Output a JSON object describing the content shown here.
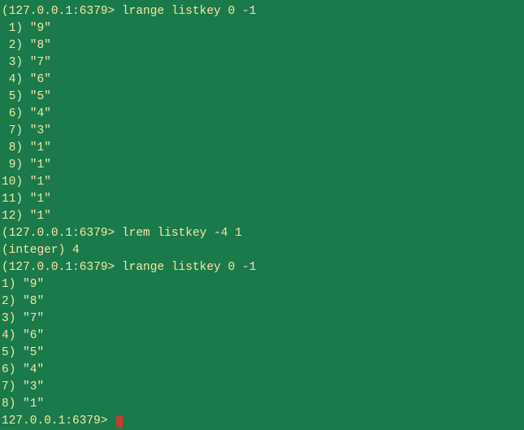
{
  "prompt": "127.0.0.1:6379>",
  "prompt_paren": "(127.0.0.1:6379>",
  "cmd1": "lrange listkey 0 -1",
  "list1": [
    {
      "idx": " 1)",
      "val": "\"9\""
    },
    {
      "idx": " 2)",
      "val": "\"8\""
    },
    {
      "idx": " 3)",
      "val": "\"7\""
    },
    {
      "idx": " 4)",
      "val": "\"6\""
    },
    {
      "idx": " 5)",
      "val": "\"5\""
    },
    {
      "idx": " 6)",
      "val": "\"4\""
    },
    {
      "idx": " 7)",
      "val": "\"3\""
    },
    {
      "idx": " 8)",
      "val": "\"1\""
    },
    {
      "idx": " 9)",
      "val": "\"1\""
    },
    {
      "idx": "10)",
      "val": "\"1\""
    },
    {
      "idx": "11)",
      "val": "\"1\""
    },
    {
      "idx": "12)",
      "val": "\"1\""
    }
  ],
  "cmd2": "lrem listkey -4 1",
  "result2": "(integer) 4",
  "cmd3": "lrange listkey 0 -1",
  "list3": [
    {
      "idx": "1)",
      "val": "\"9\""
    },
    {
      "idx": "2)",
      "val": "\"8\""
    },
    {
      "idx": "3)",
      "val": "\"7\""
    },
    {
      "idx": "4)",
      "val": "\"6\""
    },
    {
      "idx": "5)",
      "val": "\"5\""
    },
    {
      "idx": "6)",
      "val": "\"4\""
    },
    {
      "idx": "7)",
      "val": "\"3\""
    },
    {
      "idx": "8)",
      "val": "\"1\""
    }
  ]
}
